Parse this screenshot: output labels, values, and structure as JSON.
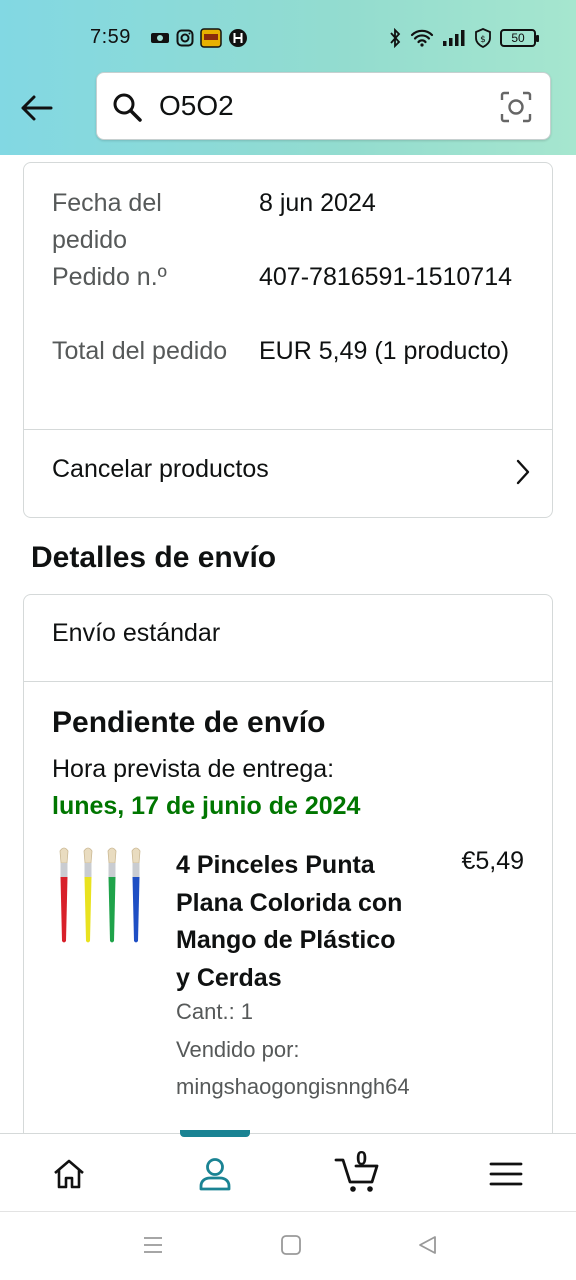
{
  "status_bar": {
    "time": "7:59",
    "battery": "50",
    "left_icons": [
      "map-icon",
      "instagram-icon",
      "app-badge-icon",
      "h-icon"
    ],
    "right_icons": [
      "bluetooth-icon",
      "wifi-icon",
      "signal-icon",
      "vpn-shield-icon",
      "battery-icon"
    ]
  },
  "header": {
    "search_value": "O5O2"
  },
  "order_summary": {
    "date_label": "Fecha del pedido",
    "date_value": "8 jun 2024",
    "number_label": "Pedido n.º",
    "number_value": "407-7816591-1510714",
    "total_label": "Total del pedido",
    "total_value": "EUR 5,49 (1 producto)",
    "cancel_label": "Cancelar productos"
  },
  "shipping": {
    "section_title": "Detalles de envío",
    "method": "Envío estándar",
    "status": "Pendiente de envío",
    "eta_label": "Hora prevista de entrega:",
    "eta_date": "lunes, 17 de junio de 2024",
    "product": {
      "title": "4 Pinceles Punta Plana Colorida con Mango de Plástico y Cerdas",
      "price": "€5,49",
      "quantity": "Cant.: 1",
      "sold_by_label": "Vendido por:",
      "sold_by_value": "mingshaogongisnngh64",
      "brush_colors": [
        "#d8202a",
        "#e9e21f",
        "#1fa34a",
        "#1f4fc4"
      ]
    }
  },
  "bottom_nav": {
    "cart_count": "0",
    "active": "account",
    "accent": "#1a8393"
  }
}
